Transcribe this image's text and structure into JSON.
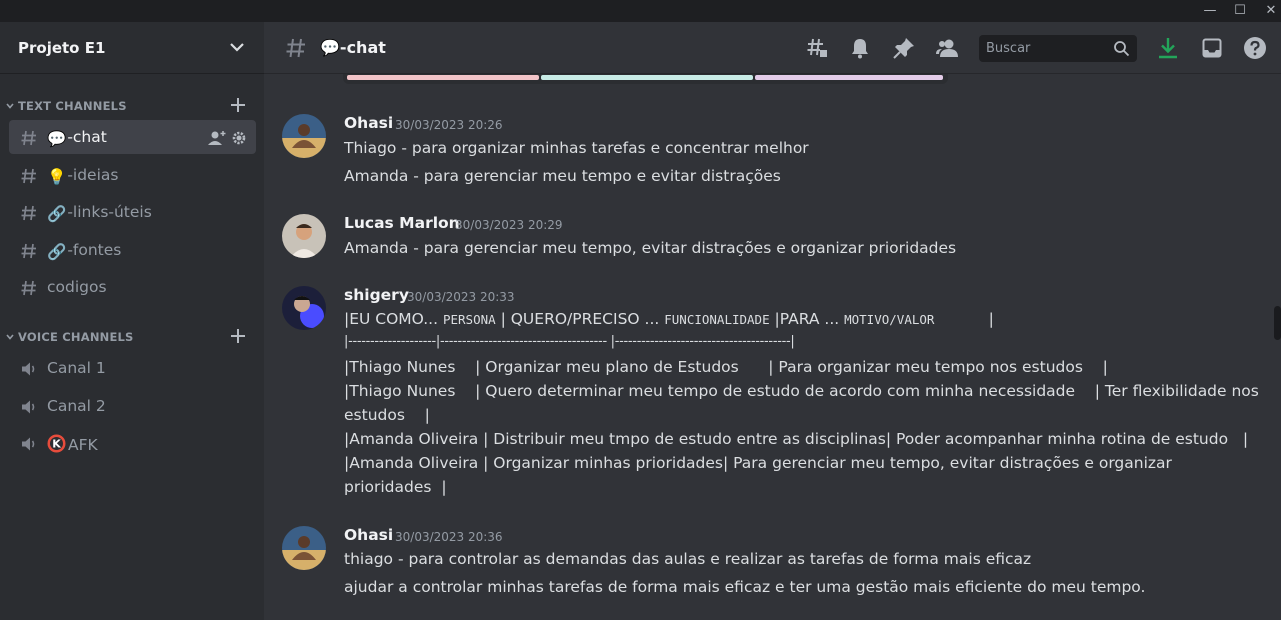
{
  "window": {
    "controls": [
      "—",
      "☐",
      "✕"
    ]
  },
  "server": {
    "name": "Projeto E1"
  },
  "sidebar": {
    "text_category": "TEXT CHANNELS",
    "voice_category": "VOICE CHANNELS",
    "text_channels": [
      {
        "emoji": "💬",
        "label": "-chat",
        "active": true
      },
      {
        "emoji": "💡",
        "label": "-ideias",
        "active": false
      },
      {
        "emoji": "🔗",
        "label": "-links-úteis",
        "active": false
      },
      {
        "emoji": "🔗",
        "label": "-fontes",
        "active": false
      },
      {
        "emoji": "",
        "label": "codigos",
        "active": false
      }
    ],
    "voice_channels": [
      {
        "label": "Canal 1"
      },
      {
        "label": "Canal 2"
      },
      {
        "label": "AFK",
        "badge": "K"
      }
    ]
  },
  "header": {
    "channel_emoji": "💬",
    "channel_name": "-chat",
    "search_placeholder": "Buscar"
  },
  "colors": {
    "accent_download": "#23a55a",
    "sidebar_bg": "#2b2d31",
    "main_bg": "#313338",
    "active_channel_bg": "#404249"
  },
  "messages": [
    {
      "author": "Ohasi",
      "timestamp": "30/03/2023 20:26",
      "lines": [
        "Thiago - para organizar minhas tarefas e concentrar melhor",
        "Amanda - para gerenciar meu tempo e evitar distrações"
      ]
    },
    {
      "author": "Lucas Marlon",
      "timestamp": "30/03/2023 20:29",
      "lines": [
        "Amanda - para gerenciar meu tempo, evitar distrações e organizar prioridades"
      ]
    },
    {
      "author": "shigery",
      "timestamp": "30/03/2023 20:33",
      "header_parts": [
        "|EU COMO... ",
        "PERSONA",
        " | QUERO/PRECISO ... ",
        "FUNCIONALIDADE",
        "   |PARA ... ",
        "MOTIVO/VALOR",
        "           |"
      ],
      "lines": [
        "|--------------------|-------------------------------------- |----------------------------------------|",
        "|Thiago Nunes    | Organizar meu plano de Estudos      | Para organizar meu tempo nos estudos    |",
        "|Thiago Nunes    | Quero determinar meu tempo de estudo de acordo com minha necessidade    | Ter flexibilidade nos",
        "estudos    |",
        "|Amanda Oliveira | Distribuir meu tmpo de estudo entre as disciplinas| Poder acompanhar minha rotina de estudo   |",
        "|Amanda Oliveira | Organizar minhas prioridades| Para gerenciar meu tempo, evitar distrações e organizar",
        "prioridades  |"
      ]
    },
    {
      "author": "Ohasi",
      "timestamp": "30/03/2023 20:36",
      "lines": [
        "thiago - para controlar as demandas das aulas e realizar as tarefas de forma mais eficaz",
        "ajudar a controlar minhas tarefas de forma mais eficaz e ter uma gestão mais eficiente do meu tempo."
      ]
    }
  ]
}
